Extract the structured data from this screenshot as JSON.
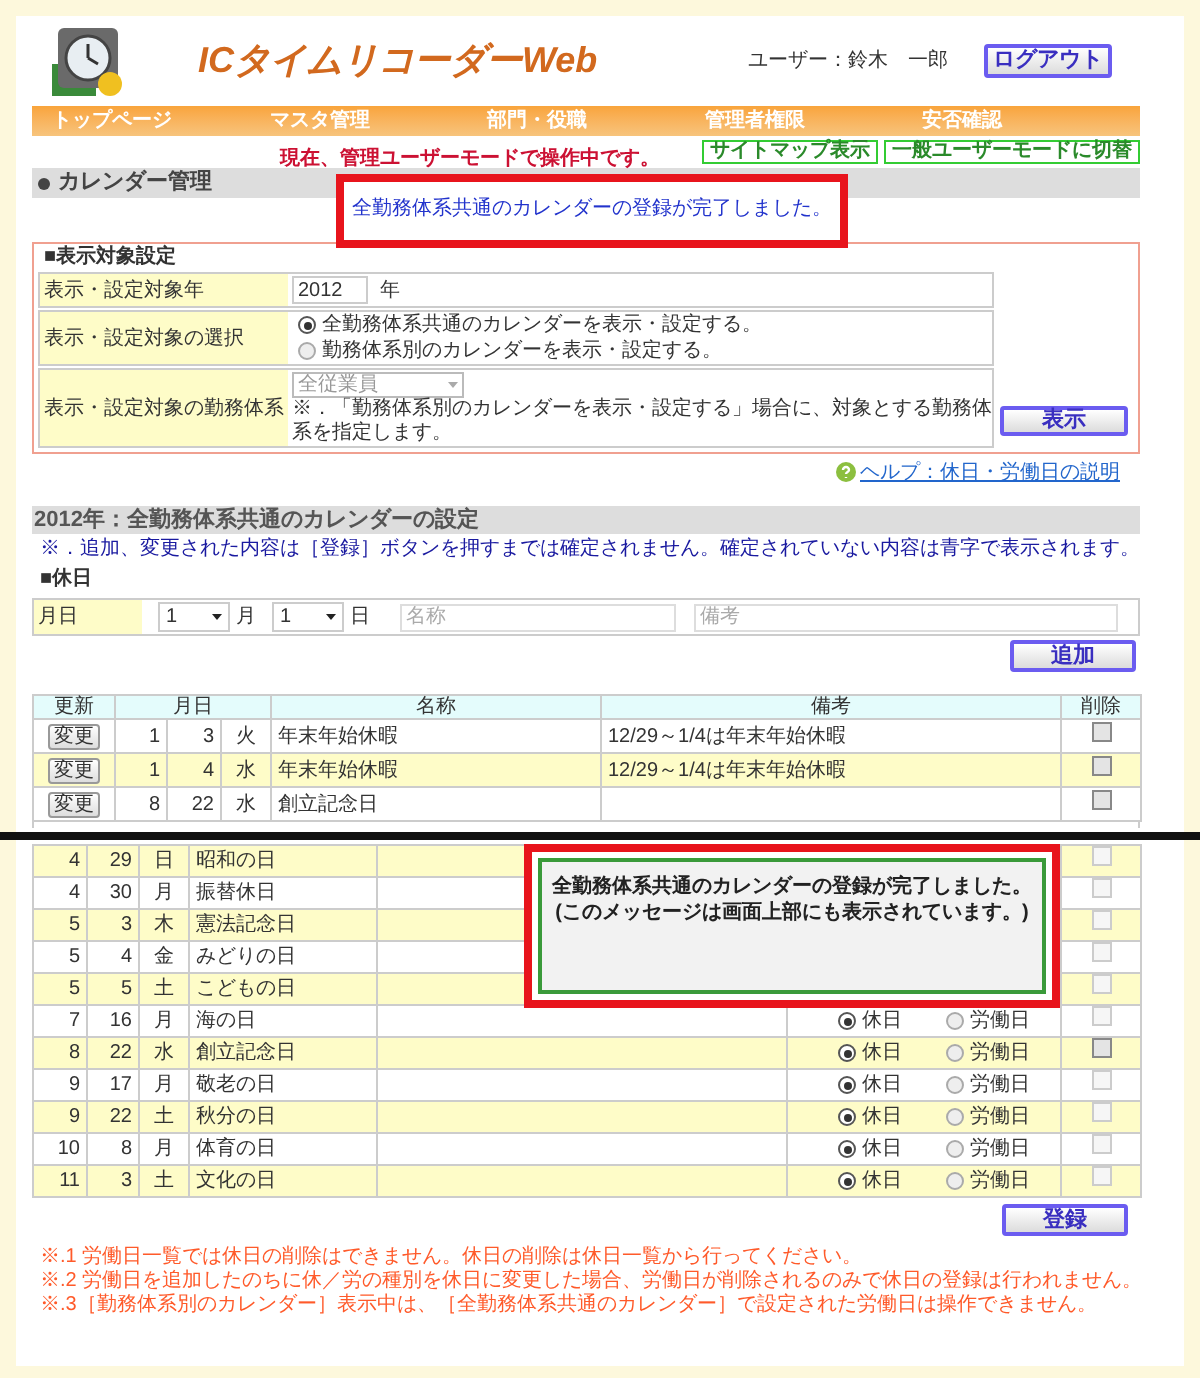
{
  "app": {
    "title": "ICタイムリコーダーWeb",
    "user_label": "ユーザー：鈴木　一郎",
    "logout": "ログアウト"
  },
  "nav": [
    "トップページ",
    "マスタ管理",
    "部門・役職",
    "管理者権限",
    "安否確認"
  ],
  "mode_notice": "現在、管理ユーザーモードで操作中です。",
  "mode_buttons": [
    "サイトマップ表示",
    "一般ユーザーモードに切替"
  ],
  "page_title": "カレンダー管理",
  "top_message": "全勤務体系共通のカレンダーの登録が完了しました。",
  "settings": {
    "heading": "■表示対象設定",
    "year_label": "表示・設定対象年",
    "year": "2012",
    "year_unit": "年",
    "select_label": "表示・設定対象の選択",
    "options": [
      {
        "label": "全勤務体系共通のカレンダーを表示・設定する。",
        "selected": true
      },
      {
        "label": "勤務体系別のカレンダーを表示・設定する。",
        "selected": false
      }
    ],
    "system_label": "表示・設定対象の勤務体系",
    "system_value": "全従業員",
    "system_note": "※．「勤務体系別のカレンダーを表示・設定する」場合に、対象とする勤務体系を指定します。",
    "show_button": "表示"
  },
  "help_link": "ヘルプ：休日・労働日の説明",
  "section": {
    "title": "2012年：全勤務体系共通のカレンダーの設定",
    "note": "※．追加、変更された内容は［登録］ボタンを押すまでは確定されません。確定されていない内容は青字で表示されます。",
    "holiday_heading": "■休日",
    "date_label": "月日",
    "month": "1",
    "month_unit": "月",
    "day": "1",
    "day_unit": "日",
    "name_placeholder": "名称",
    "note_placeholder": "備考",
    "add_button": "追加"
  },
  "holiday_table": {
    "columns": [
      "更新",
      "月日",
      "名称",
      "備考",
      "削除"
    ],
    "rows": [
      {
        "edit": "変更",
        "month": "1",
        "day": "3",
        "weekday": "火",
        "name": "年末年始休暇",
        "note": "12/29～1/4は年末年始休暇",
        "checked": false
      },
      {
        "edit": "変更",
        "month": "1",
        "day": "4",
        "weekday": "水",
        "name": "年末年始休暇",
        "note": "12/29～1/4は年末年始休暇",
        "checked": false
      },
      {
        "edit": "変更",
        "month": "8",
        "day": "22",
        "weekday": "水",
        "name": "創立記念日",
        "checked": false
      }
    ]
  },
  "lower_table": {
    "rows": [
      {
        "month": "4",
        "day": "29",
        "weekday": "日",
        "name": "昭和の日",
        "checked": false,
        "disabled": true
      },
      {
        "month": "4",
        "day": "30",
        "weekday": "月",
        "name": "振替休日",
        "checked": false,
        "disabled": true
      },
      {
        "month": "5",
        "day": "3",
        "weekday": "木",
        "name": "憲法記念日",
        "checked": false,
        "disabled": true
      },
      {
        "month": "5",
        "day": "4",
        "weekday": "金",
        "name": "みどりの日",
        "checked": false,
        "disabled": true
      },
      {
        "month": "5",
        "day": "5",
        "weekday": "土",
        "name": "こどもの日",
        "checked": false,
        "disabled": true
      },
      {
        "month": "7",
        "day": "16",
        "weekday": "月",
        "name": "海の日",
        "options": [
          {
            "label": "休日",
            "selected": true
          },
          {
            "label": "労働日",
            "selected": false
          }
        ],
        "checked": false,
        "disabled": true
      },
      {
        "month": "8",
        "day": "22",
        "weekday": "水",
        "name": "創立記念日",
        "options": [
          {
            "label": "休日",
            "selected": true
          },
          {
            "label": "労働日",
            "selected": false
          }
        ],
        "checked": false,
        "disabled": false
      },
      {
        "month": "9",
        "day": "17",
        "weekday": "月",
        "name": "敬老の日",
        "options": [
          {
            "label": "休日",
            "selected": true
          },
          {
            "label": "労働日",
            "selected": false
          }
        ],
        "checked": false,
        "disabled": true
      },
      {
        "month": "9",
        "day": "22",
        "weekday": "土",
        "name": "秋分の日",
        "options": [
          {
            "label": "休日",
            "selected": true
          },
          {
            "label": "労働日",
            "selected": false
          }
        ],
        "checked": false,
        "disabled": true
      },
      {
        "month": "10",
        "day": "8",
        "weekday": "月",
        "name": "体育の日",
        "options": [
          {
            "label": "休日",
            "selected": true
          },
          {
            "label": "労働日",
            "selected": false
          }
        ],
        "checked": false,
        "disabled": true
      },
      {
        "month": "11",
        "day": "3",
        "weekday": "土",
        "name": "文化の日",
        "options": [
          {
            "label": "休日",
            "selected": true
          },
          {
            "label": "労働日",
            "selected": false
          }
        ],
        "checked": false,
        "disabled": true
      }
    ]
  },
  "popup": {
    "lines": [
      "全勤務体系共通のカレンダーの登録が完了しました。",
      "(このメッセージは画面上部にも表示されています。)"
    ]
  },
  "register_button": "登録",
  "footnotes": [
    "※.1 労働日一覧では休日の削除はできません。休日の削除は休日一覧から行ってください。",
    "※.2 労働日を追加したのちに休／労の種別を休日に変更した場合、労働日が削除されるのみで休日の登録は行われません。",
    "※.3［勤務体系別のカレンダー］表示中は、［全勤務体系共通のカレンダー］で設定された労働日は操作できません。"
  ]
}
